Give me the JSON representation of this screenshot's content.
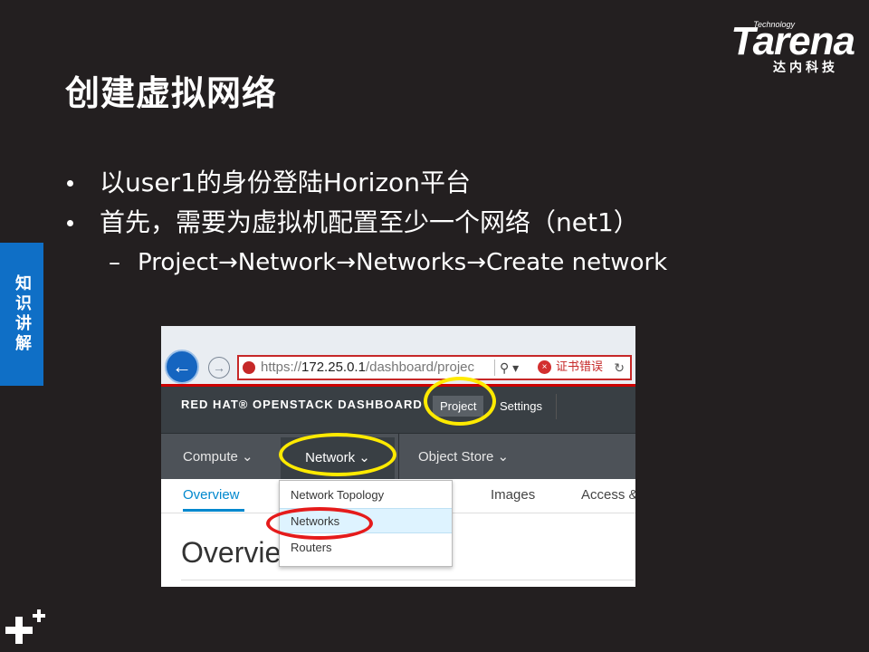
{
  "slide": {
    "title": "创建虚拟网络",
    "logo": {
      "top": "Technology",
      "main": "Tarena",
      "sub": "达内科技"
    },
    "side_tab": "知识讲解",
    "bullets": [
      "以user1的身份登陆Horizon平台",
      "首先，需要为虚拟机配置至少一个网络（net1）"
    ],
    "sub_bullet": {
      "dash": "–",
      "text": "Project→Network→Networks→Create network"
    }
  },
  "screenshot": {
    "browser": {
      "back_glyph": "←",
      "forward_glyph": "→",
      "url_prefix": "https://",
      "url_host": "172.25.0.1",
      "url_path": "/dashboard/projec",
      "search_glyph": "⚲ ▾",
      "error_glyph": "×",
      "cert_error": "证书错误",
      "reload_glyph": "↻"
    },
    "header": {
      "brand": "RED HAT® OPENSTACK DASHBOARD",
      "project_tab": "Project",
      "settings_tab": "Settings"
    },
    "nav": {
      "compute": "Compute ⌄",
      "network": "Network ⌄",
      "object_store": "Object Store ⌄"
    },
    "subtabs": {
      "overview": "Overview",
      "images": "Images",
      "access": "Access &"
    },
    "page_heading": "Overvie",
    "dropdown": [
      "Network Topology",
      "Networks",
      "Routers"
    ],
    "highlight_colors": {
      "yellow": "#ffea00",
      "red": "#e51b1b"
    }
  }
}
